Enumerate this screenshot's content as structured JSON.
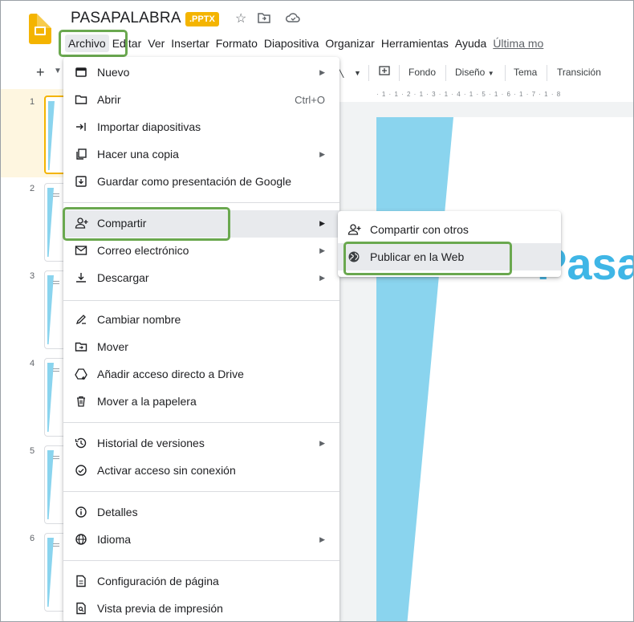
{
  "header": {
    "doc_title": "PASAPALABRA",
    "badge": ".PPTX",
    "icons": [
      "star-icon",
      "move-to-folder-icon",
      "cloud-status-icon"
    ]
  },
  "menubar": {
    "items": [
      "Archivo",
      "Editar",
      "Ver",
      "Insertar",
      "Formato",
      "Diapositiva",
      "Organizar",
      "Herramientas",
      "Ayuda",
      "Última mo"
    ]
  },
  "toolbar": {
    "plus": "+",
    "fondo": "Fondo",
    "diseno": "Diseño",
    "tema": "Tema",
    "transicion": "Transición"
  },
  "filmstrip": {
    "slides": [
      "1",
      "2",
      "3",
      "4",
      "5",
      "6"
    ],
    "active": "1"
  },
  "ruler": "· 1 · 1 · 2 · 1 · 3 · 1 · 4 · 1 · 5 · 1 · 6 · 1 · 7 · 1 · 8",
  "slide": {
    "title_fragment": "Pasa"
  },
  "file_menu": {
    "items": [
      {
        "label": "Nuevo",
        "icon": "new-presentation-icon",
        "submenu": true
      },
      {
        "label": "Abrir",
        "icon": "folder-open-icon",
        "shortcut": "Ctrl+O"
      },
      {
        "label": "Importar diapositivas",
        "icon": "import-icon"
      },
      {
        "label": "Hacer una copia",
        "icon": "copy-icon",
        "submenu": true
      },
      {
        "label": "Guardar como presentación de Google",
        "icon": "save-icon"
      },
      {
        "label": "Compartir",
        "icon": "share-person-icon",
        "submenu": true,
        "active": true
      },
      {
        "label": "Correo electrónico",
        "icon": "email-icon",
        "submenu": true
      },
      {
        "label": "Descargar",
        "icon": "download-icon",
        "submenu": true
      },
      {
        "label": "Cambiar nombre",
        "icon": "rename-icon"
      },
      {
        "label": "Mover",
        "icon": "move-folder-icon"
      },
      {
        "label": "Añadir acceso directo a Drive",
        "icon": "drive-shortcut-icon"
      },
      {
        "label": "Mover a la papelera",
        "icon": "trash-icon"
      },
      {
        "label": "Historial de versiones",
        "icon": "history-icon",
        "submenu": true
      },
      {
        "label": "Activar acceso sin conexión",
        "icon": "offline-icon"
      },
      {
        "label": "Detalles",
        "icon": "info-icon"
      },
      {
        "label": "Idioma",
        "icon": "globe-icon",
        "submenu": true
      },
      {
        "label": "Configuración de página",
        "icon": "page-setup-icon"
      },
      {
        "label": "Vista previa de impresión",
        "icon": "print-preview-icon"
      }
    ]
  },
  "share_submenu": {
    "items": [
      {
        "label": "Compartir con otros",
        "icon": "share-person-icon"
      },
      {
        "label": "Publicar en la Web",
        "icon": "globe-icon",
        "active": true
      }
    ]
  },
  "colors": {
    "highlight_outline": "#6aa84f",
    "slides_accent": "#f4b400",
    "slide_stripe": "#8ad4ee",
    "slide_title": "#3fb6e6"
  }
}
